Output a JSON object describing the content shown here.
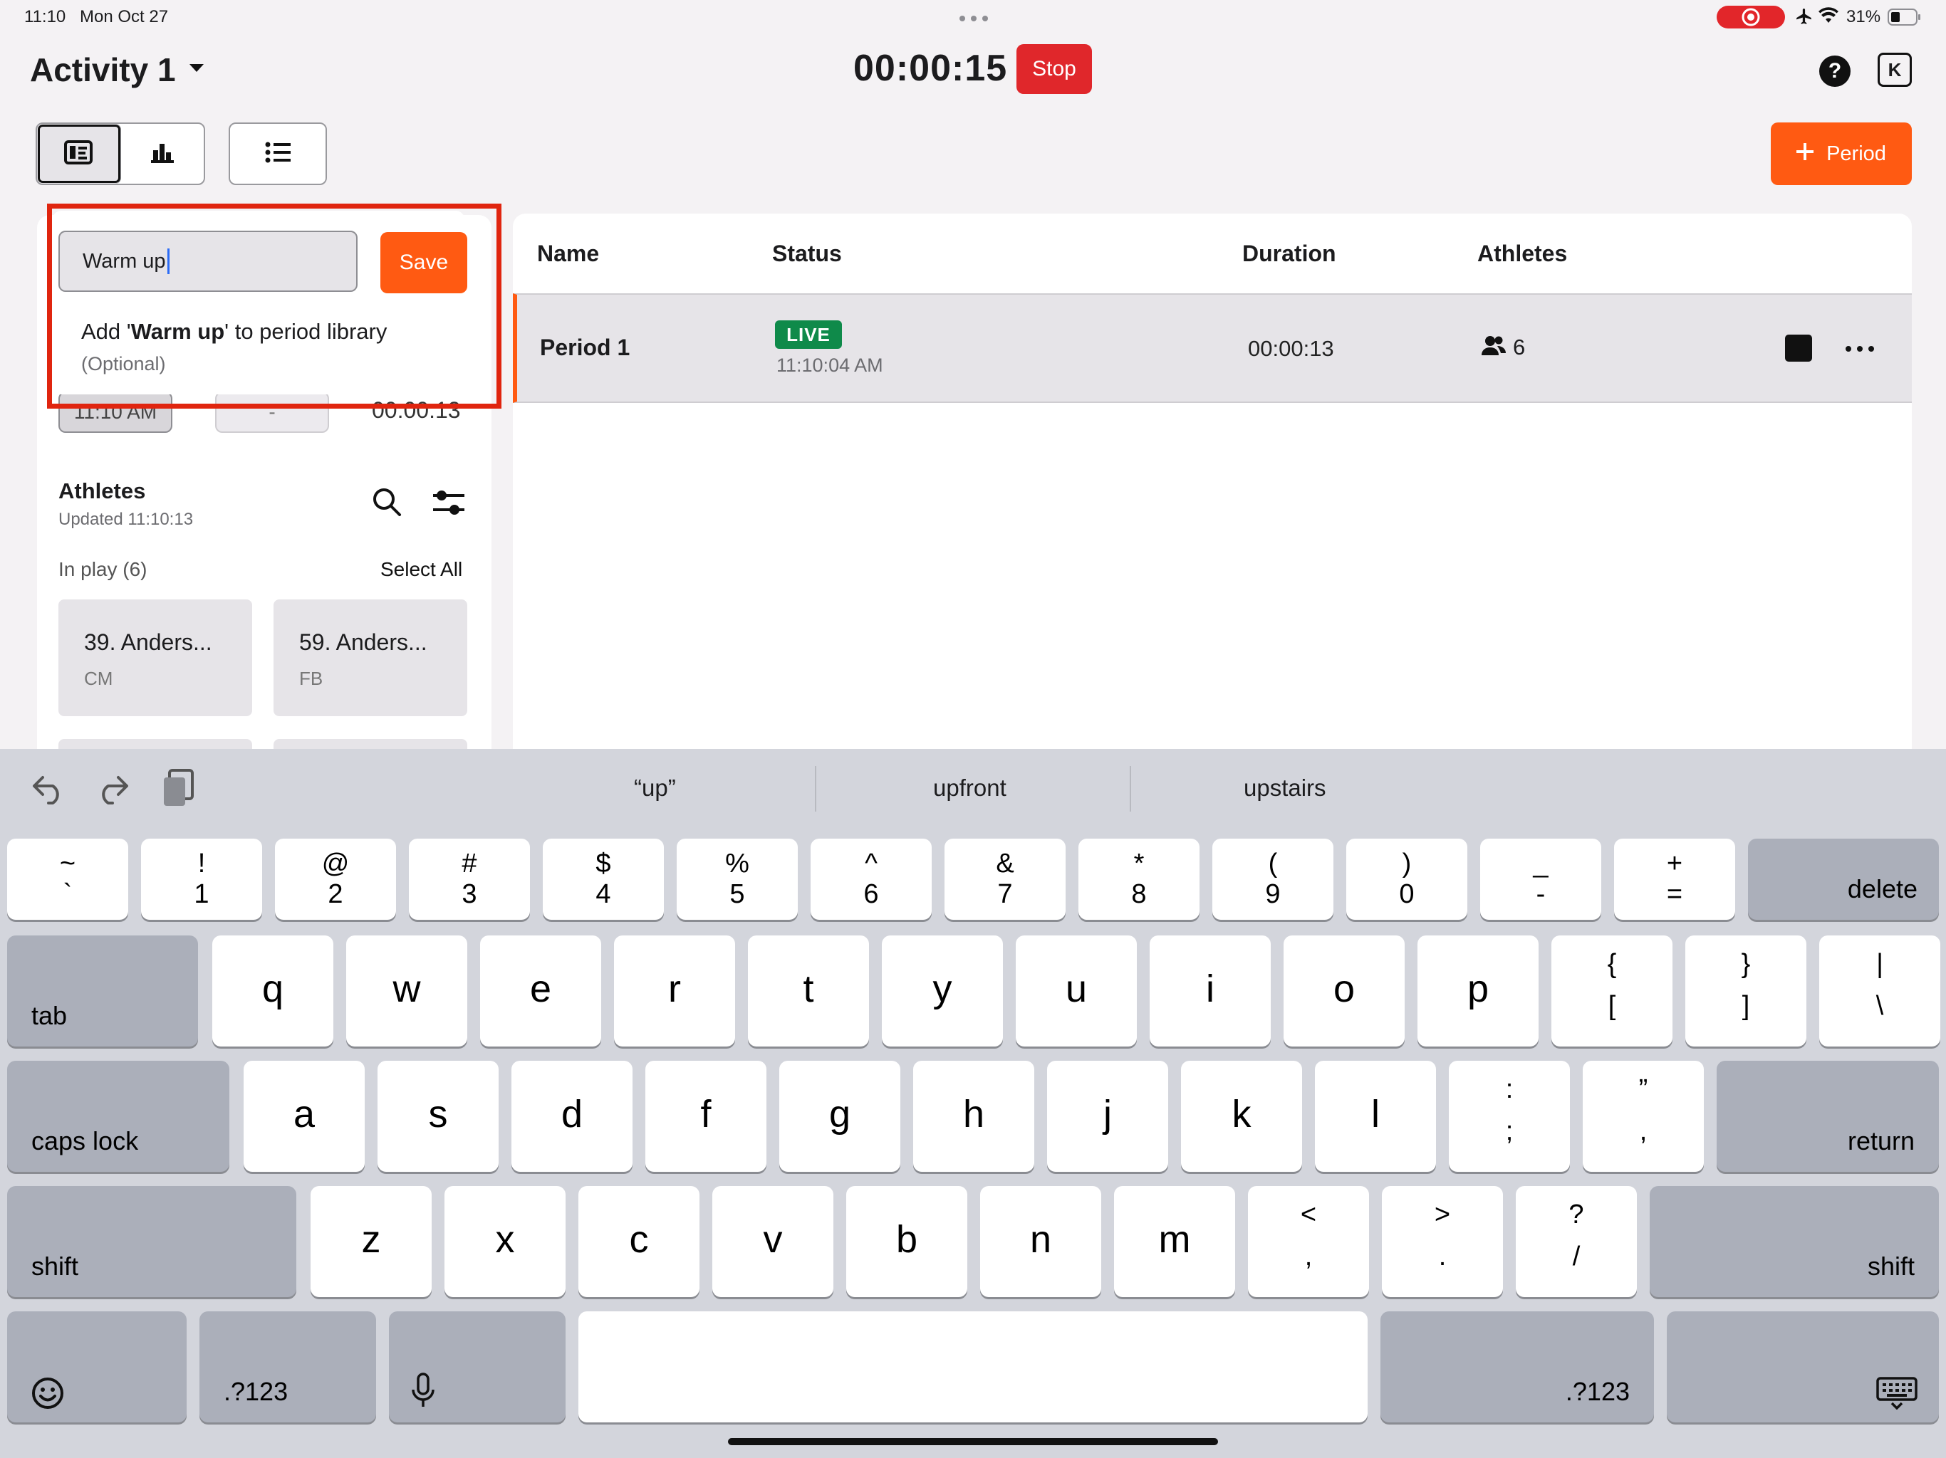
{
  "status_bar": {
    "time": "11:10",
    "date": "Mon Oct 27",
    "battery": "31%"
  },
  "header": {
    "activity_title": "Activity 1",
    "timer": "00:00:15",
    "stop_label": "Stop",
    "help_label": "?",
    "user_initial": "K",
    "add_period_label": "Period"
  },
  "popover": {
    "input_value": "Warm up",
    "save_label": "Save",
    "hint_prefix": "Add '",
    "hint_bold": "Warm up",
    "hint_suffix": "' to period library",
    "hint_optional": "(Optional)"
  },
  "left_panel": {
    "start_time_partial": "11:10 AM",
    "end_time_partial": "-",
    "duration_partial": "00:00:13",
    "athletes_title": "Athletes",
    "athletes_updated": "Updated 11:10:13",
    "in_play": "In play (6)",
    "select_all": "Select All",
    "cards": [
      {
        "name": "39. Anders...",
        "position": "CM"
      },
      {
        "name": "59. Anders...",
        "position": "FB"
      }
    ]
  },
  "table": {
    "headers": {
      "name": "Name",
      "status": "Status",
      "duration": "Duration",
      "athletes": "Athletes"
    },
    "rows": [
      {
        "name": "Period 1",
        "status_badge": "LIVE",
        "status_time": "11:10:04 AM",
        "duration": "00:00:13",
        "athletes_count": "6"
      }
    ]
  },
  "keyboard": {
    "suggestions": [
      "“up”",
      "upfront",
      "upstairs"
    ],
    "number_row": [
      {
        "top": "~",
        "bottom": "`"
      },
      {
        "top": "!",
        "bottom": "1"
      },
      {
        "top": "@",
        "bottom": "2"
      },
      {
        "top": "#",
        "bottom": "3"
      },
      {
        "top": "$",
        "bottom": "4"
      },
      {
        "top": "%",
        "bottom": "5"
      },
      {
        "top": "^",
        "bottom": "6"
      },
      {
        "top": "&",
        "bottom": "7"
      },
      {
        "top": "*",
        "bottom": "8"
      },
      {
        "top": "(",
        "bottom": "9"
      },
      {
        "top": ")",
        "bottom": "0"
      },
      {
        "top": "_",
        "bottom": "-"
      },
      {
        "top": "+",
        "bottom": "="
      }
    ],
    "row_q": [
      "q",
      "w",
      "e",
      "r",
      "t",
      "y",
      "u",
      "i",
      "o",
      "p"
    ],
    "row_q_symbols": [
      {
        "top": "{",
        "bottom": "["
      },
      {
        "top": "}",
        "bottom": "]"
      },
      {
        "top": "|",
        "bottom": "\\"
      }
    ],
    "row_a": [
      "a",
      "s",
      "d",
      "f",
      "g",
      "h",
      "j",
      "k",
      "l"
    ],
    "row_a_symbols": [
      {
        "top": ":",
        "bottom": ";"
      },
      {
        "top": "”",
        "bottom": ","
      }
    ],
    "row_z": [
      "z",
      "x",
      "c",
      "v",
      "b",
      "n",
      "m"
    ],
    "row_z_symbols": [
      {
        "top": "<",
        "bottom": ","
      },
      {
        "top": ">",
        "bottom": "."
      },
      {
        "top": "?",
        "bottom": "/"
      }
    ],
    "delete_label": "delete",
    "tab_label": "tab",
    "caps_label": "caps lock",
    "return_label": "return",
    "shift_label": "shift",
    "numbers_label": ".?123"
  }
}
